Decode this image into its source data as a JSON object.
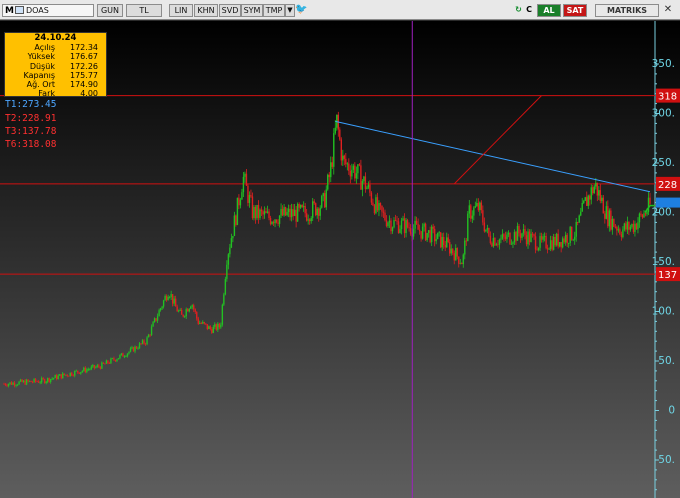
{
  "toolbar": {
    "brand_letter": "M",
    "symbol": "DOAS",
    "buttons": [
      "GUN",
      "TL",
      "LIN",
      "KHN",
      "SVD",
      "SYM",
      "TMP"
    ],
    "al_label": "AL",
    "sat_label": "SAT",
    "brand": "MATRIKS",
    "icons": [
      "chart-icon",
      "dropdown-icon",
      "twitter-icon",
      "refresh-icon",
      "c-icon",
      "close-icon"
    ]
  },
  "info_box": {
    "date": "24.10.24",
    "rows": [
      {
        "label": "Açılış",
        "value": "172.34"
      },
      {
        "label": "Yüksek",
        "value": "176.67"
      },
      {
        "label": "Düşük",
        "value": "172.26"
      },
      {
        "label": "Kapanış",
        "value": "175.77"
      },
      {
        "label": "Ağ. Ort",
        "value": "174.90"
      },
      {
        "label": "Fark",
        "value": "4.00"
      }
    ],
    "background": "#ffc000"
  },
  "trend_labels": [
    {
      "text": "T1:273.45",
      "color": "#4da6ff"
    },
    {
      "text": "T2:228.91",
      "color": "#ff3030"
    },
    {
      "text": "T3:137.78",
      "color": "#ff3030"
    },
    {
      "text": "T6:318.08",
      "color": "#ff3030"
    }
  ],
  "chart_data": {
    "type": "candlestick",
    "y_axis": {
      "side": "right",
      "ticks": [
        350,
        300,
        250,
        200,
        150,
        100,
        50,
        0,
        -50
      ],
      "tick_labels": [
        "350.",
        "300.",
        "250.",
        "200.",
        "150.",
        "100.",
        "50.",
        "0",
        "-50."
      ],
      "range": [
        -60,
        385
      ]
    },
    "horizontal_lines": [
      {
        "value": 318.08,
        "label": "318",
        "color": "#d01010"
      },
      {
        "value": 228.91,
        "label": "228",
        "color": "#d01010"
      },
      {
        "value": 137.78,
        "label": "137",
        "color": "#d01010"
      }
    ],
    "last_price": {
      "value": 207,
      "color": "#1e7fe0"
    },
    "trend_line": {
      "start": [
        0.513,
        292
      ],
      "end": [
        1.0,
        221
      ],
      "color": "#3aa0ff"
    },
    "channel_line": {
      "start": [
        0.697,
        228.9
      ],
      "end": [
        0.832,
        318.08
      ],
      "color": "#d01010"
    },
    "cursor_x_fraction": 0.632,
    "cursor_color": "#a020c0",
    "up_color": "#22c022",
    "down_color": "#e02020",
    "price_path": [
      [
        0.0,
        27
      ],
      [
        0.06,
        30
      ],
      [
        0.1,
        37
      ],
      [
        0.15,
        45
      ],
      [
        0.19,
        58
      ],
      [
        0.22,
        70
      ],
      [
        0.24,
        100
      ],
      [
        0.255,
        122
      ],
      [
        0.265,
        105
      ],
      [
        0.275,
        95
      ],
      [
        0.29,
        110
      ],
      [
        0.3,
        90
      ],
      [
        0.32,
        82
      ],
      [
        0.335,
        85
      ],
      [
        0.345,
        155
      ],
      [
        0.36,
        200
      ],
      [
        0.37,
        236
      ],
      [
        0.385,
        200
      ],
      [
        0.41,
        195
      ],
      [
        0.44,
        198
      ],
      [
        0.47,
        200
      ],
      [
        0.495,
        210
      ],
      [
        0.505,
        240
      ],
      [
        0.515,
        292
      ],
      [
        0.525,
        250
      ],
      [
        0.54,
        245
      ],
      [
        0.56,
        228
      ],
      [
        0.58,
        200
      ],
      [
        0.6,
        190
      ],
      [
        0.63,
        185
      ],
      [
        0.66,
        178
      ],
      [
        0.685,
        168
      ],
      [
        0.71,
        150
      ],
      [
        0.72,
        200
      ],
      [
        0.735,
        205
      ],
      [
        0.75,
        175
      ],
      [
        0.77,
        172
      ],
      [
        0.8,
        180
      ],
      [
        0.83,
        168
      ],
      [
        0.86,
        172
      ],
      [
        0.885,
        180
      ],
      [
        0.9,
        210
      ],
      [
        0.915,
        228
      ],
      [
        0.935,
        195
      ],
      [
        0.955,
        182
      ],
      [
        0.975,
        187
      ],
      [
        0.99,
        198
      ],
      [
        1.0,
        207
      ]
    ]
  }
}
